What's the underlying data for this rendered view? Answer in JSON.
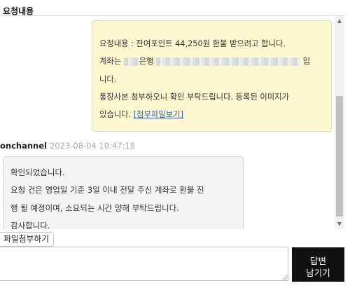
{
  "section_title": "요청내용",
  "user_message": {
    "line1": "요청내용 : 잔여포인트 44,250원 환불 받으려고 합니다.",
    "line2_prefix": "계좌는 ",
    "line2_bank": "은행",
    "line2_suffix": " 입",
    "line3": "니다.",
    "line4": "통장사본 첨부하오니 확인 부탁드립니다. 등록된 이미지가",
    "line5_prefix": "있습니다. ",
    "attachment_link": "[첨부파일보기]"
  },
  "admin_reply": {
    "author": "onchannel",
    "datetime": "2023-08-04 10:47:18",
    "line1": "확인되었습니다.",
    "line2": "요청 건은 영업일 기준 3일 이내 전달 주신 계좌로 환불 진",
    "line3": "행 될 예정이며, 소요되는 시간 양해 부탁드립니다.",
    "line4": "감사합니다."
  },
  "composer": {
    "file_attach_label": "파일첨부하기",
    "textarea_value": "",
    "submit_label_line1": "답변",
    "submit_label_line2": "남기기"
  },
  "icons": {
    "scroll_up": "scroll-up-arrow-icon",
    "scroll_down": "scroll-down-arrow-icon",
    "resize": "resize-grip-icon"
  }
}
